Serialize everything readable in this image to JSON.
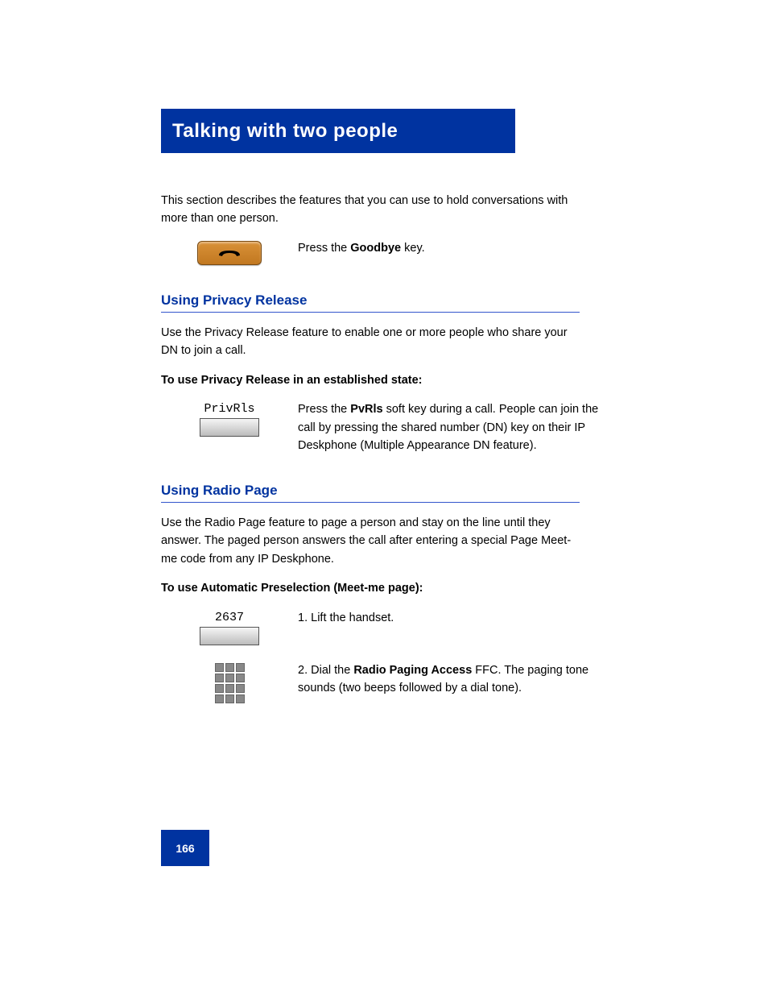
{
  "title": "Talking with two people",
  "intro": "This section describes the features that you can use to hold conversations with more than one person.",
  "step1": {
    "icon_name": "goodbye",
    "action_prefix": "Press the ",
    "action_key": "Goodbye",
    "action_suffix": " key."
  },
  "section_privacy_release": {
    "heading": "Using Privacy Release",
    "para1": "Use the Privacy Release feature to enable one or more people who share your DN to join a call.",
    "para2_bold": "To use Privacy Release in an established state:",
    "step": {
      "label": "PrivRls",
      "text_prefix": "Press the ",
      "text_key": "PvRls",
      "text_suffix": " soft key during a call. People can join the call by pressing the shared number (DN) key on their IP Deskphone (Multiple Appearance DN feature)."
    }
  },
  "section_radio_page": {
    "heading": "Using Radio Page",
    "para1": "Use the Radio Page feature to page a person and stay on the line until they answer. The paged person answers the call after entering a special Page Meet-me code from any IP Deskphone.",
    "para2_bold": "To use Automatic Preselection (Meet-me page):",
    "step1": {
      "label": "2637",
      "num": "1.",
      "text": "Lift the handset."
    },
    "step2": {
      "num": "2.",
      "text_prefix": "Dial the ",
      "text_key": "Radio Paging Access",
      "text_suffix": " FFC. The paging tone sounds (two beeps followed by a dial tone)."
    }
  },
  "page_number": "166"
}
